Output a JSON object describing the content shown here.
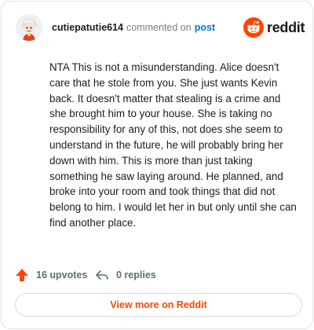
{
  "comment": {
    "username": "cutiepatutie614",
    "action_text": "commented on",
    "post_link": "post",
    "body": "NTA This is not a misunderstanding. Alice doesn't care that he stole from you. She just wants Kevin back. It doesn't matter that stealing is a crime and she brought him to your house. She is taking no responsibility for any of this, not does she seem to understand in the future, he will probably bring her down with him. This is more than just taking something he saw laying around. He planned, and broke into your room and took things that did not belong to him. I would let her in but only until she can find another place."
  },
  "brand": {
    "name": "reddit",
    "color": "#ff4500"
  },
  "actions": {
    "upvotes_label": "16 upvotes",
    "replies_label": "0 replies",
    "upvote_icon": "upvote-arrow-icon",
    "reply_icon": "reply-arrow-icon"
  },
  "footer": {
    "view_more_label": "View more on Reddit"
  }
}
